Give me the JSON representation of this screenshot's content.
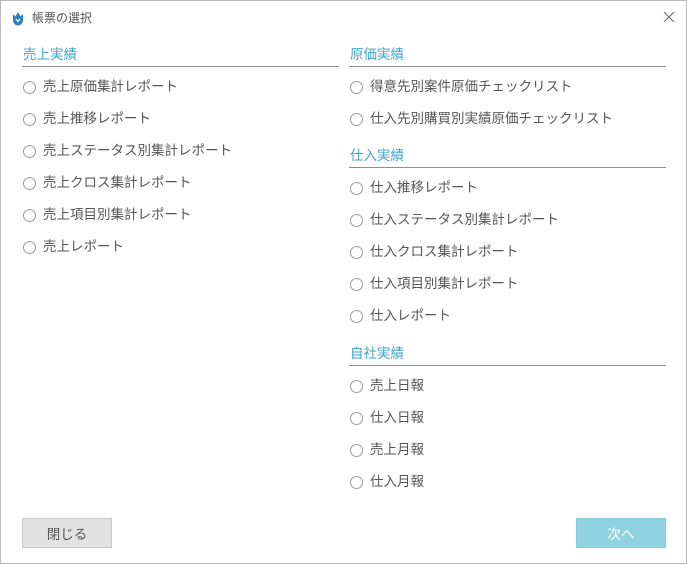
{
  "dialog": {
    "title": "帳票の選択",
    "title_icon": "tulip-logo-icon",
    "close_icon": "close-icon"
  },
  "sections": [
    {
      "header": "売上実績",
      "options": [
        "売上原価集計レポート",
        "売上推移レポート",
        "売上ステータス別集計レポート",
        "売上クロス集計レポート",
        "売上項目別集計レポート",
        "売上レポート"
      ]
    },
    {
      "header": "原価実績",
      "options": [
        "得意先別案件原価チェックリスト",
        "仕入先別購買別実績原価チェックリスト"
      ]
    },
    {
      "header": "仕入実績",
      "options": [
        "仕入推移レポート",
        "仕入ステータス別集計レポート",
        "仕入クロス集計レポート",
        "仕入項目別集計レポート",
        "仕入レポート"
      ]
    },
    {
      "header": "自社実績",
      "options": [
        "売上日報",
        "仕入日報",
        "売上月報",
        "仕入月報"
      ]
    }
  ],
  "buttons": {
    "close_label": "閉じる",
    "next_label": "次へ"
  },
  "colors": {
    "accent": "#3fa3c8",
    "next_button": "#8fd3e0",
    "close_button": "#e2e2e2"
  }
}
